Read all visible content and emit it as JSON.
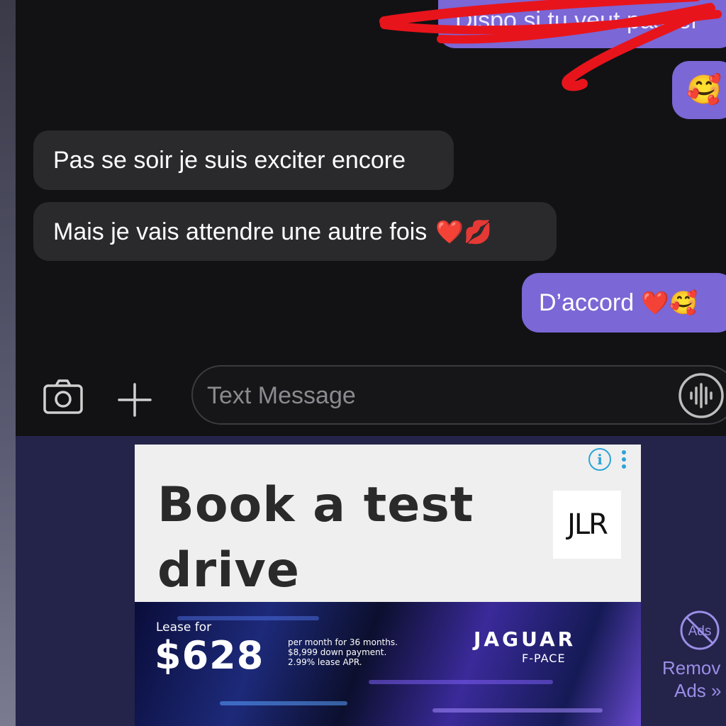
{
  "conversation": {
    "messages": [
      {
        "direction": "outgoing",
        "text": "Dispo si tu veut passer",
        "redacted": true
      },
      {
        "direction": "outgoing",
        "text": "",
        "emoji": "🥰"
      },
      {
        "direction": "incoming",
        "text": "Pas se soir je suis exciter encore"
      },
      {
        "direction": "incoming",
        "text": "Mais je vais attendre une autre fois",
        "emoji": "❤️💋"
      },
      {
        "direction": "outgoing",
        "text": "D’accord",
        "emoji": "❤️🥰"
      }
    ]
  },
  "composer": {
    "placeholder": "Text Message",
    "camera_icon": "camera-icon",
    "add_icon": "plus-icon",
    "voice_icon": "voice-waveform-icon"
  },
  "ad": {
    "headline": "Book a test drive",
    "logo_text": "JLR",
    "info_icon": "info-icon",
    "menu_icon": "kebab-menu-icon",
    "lease_label": "Lease for",
    "price": "$628",
    "terms": [
      "per month for 36 months.",
      "$8,999 down payment.",
      "2.99% lease APR."
    ],
    "brand": "JAGUAR",
    "model": "F-PACE"
  },
  "remove_ads": {
    "icon": "no-ads-icon",
    "icon_text": "Ads",
    "label_line1": "Remov",
    "label_line2": "Ads »"
  },
  "colors": {
    "outgoing_bubble": "#7b67d6",
    "incoming_bubble": "#2a2a2d",
    "scribble": "#e8141c",
    "ad_background": "#24234a",
    "remove_ads_accent": "#9a8ee6"
  }
}
